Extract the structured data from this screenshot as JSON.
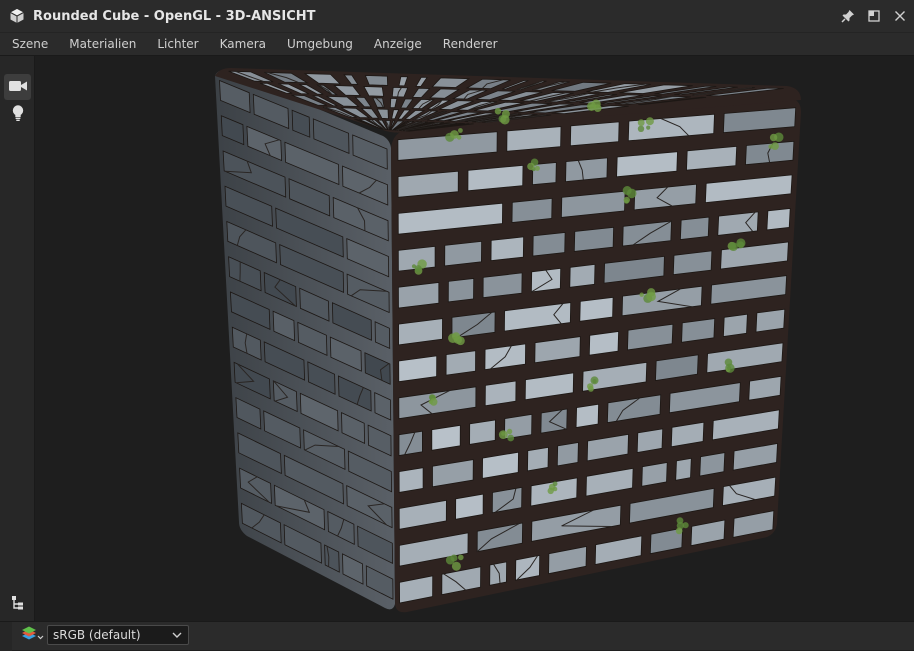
{
  "window": {
    "title": "Rounded Cube - OpenGL - 3D-ANSICHT",
    "icon": "cube-icon",
    "controls": [
      "pin-icon",
      "maximize-icon",
      "close-icon"
    ]
  },
  "menu": {
    "items": [
      "Szene",
      "Materialien",
      "Lichter",
      "Kamera",
      "Umgebung",
      "Anzeige",
      "Renderer"
    ]
  },
  "toolbar": {
    "tools": [
      {
        "icon": "camera-icon",
        "active": true
      },
      {
        "icon": "light-bulb-icon",
        "active": false
      },
      {
        "icon": "scene-tree-icon",
        "active": false
      }
    ]
  },
  "viewport": {
    "content": "stone-brick-cube-render"
  },
  "status": {
    "layers_icon": "layers-icon",
    "color_space": "sRGB (default)"
  },
  "colors": {
    "chrome": "#2b2b2b",
    "viewport_bg": "#1e1e1e",
    "text": "#d6d6d6",
    "moss": "#5d8a3a",
    "stone": "#9aa3ab"
  }
}
